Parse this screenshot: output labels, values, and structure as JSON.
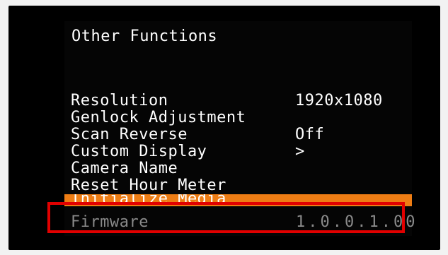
{
  "menu": {
    "title": "Other Functions",
    "items": [
      {
        "label": "Resolution",
        "value": "1920x1080"
      },
      {
        "label": "Genlock Adjustment",
        "value": ""
      },
      {
        "label": "Scan Reverse",
        "value": "Off"
      },
      {
        "label": "Custom Display",
        "value": ">"
      },
      {
        "label": "Camera Name",
        "value": ""
      },
      {
        "label": "Reset Hour Meter",
        "value": ""
      },
      {
        "label": "Initialize Media",
        "value": ""
      },
      {
        "label": "Firmware",
        "value": "1.0.0.1.00"
      }
    ]
  },
  "colors": {
    "highlight": "#ee7d14",
    "callout_border": "#e10000",
    "disabled_text": "#8a8a8a",
    "background": "#000000"
  }
}
